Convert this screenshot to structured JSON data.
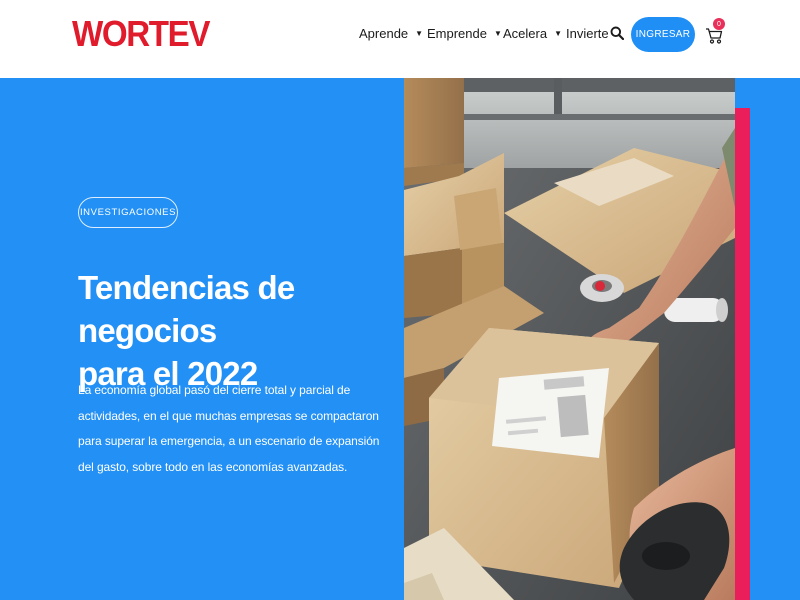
{
  "header": {
    "logo_text": "WORTEV",
    "nav": [
      {
        "label": "Aprende",
        "has_dropdown": true
      },
      {
        "label": "Emprende",
        "has_dropdown": true
      },
      {
        "label": "Acelera",
        "has_dropdown": true
      },
      {
        "label": "Invierte",
        "has_dropdown": false
      }
    ],
    "search_icon": "search-icon",
    "login_label": "INGRESAR",
    "cart_icon": "cart-icon",
    "cart_count": "0"
  },
  "hero": {
    "badge": "INVESTIGACIONES",
    "title_line1": "Tendencias de negocios",
    "title_line2": "para el 2022",
    "description": "La economía global pasó del cierre total y parcial de actividades, en el que muchas empresas se compactaron para superar la emergencia, a un escenario de expansión del gasto, sobre todo en las economías avanzadas."
  },
  "colors": {
    "brand_red": "#e01b2c",
    "hero_blue": "#2290f5",
    "button_blue": "#1f8ff6",
    "accent_pink": "#ea1e5b"
  }
}
